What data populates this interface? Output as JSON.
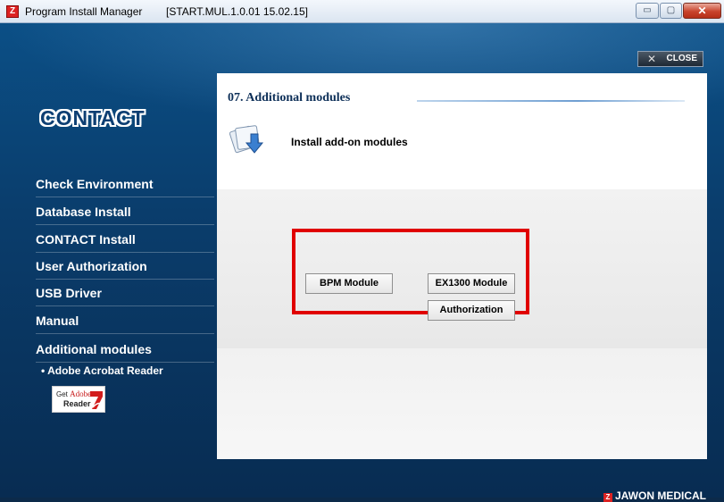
{
  "window": {
    "title": "Program Install Manager",
    "version": "[START.MUL.1.0.01 15.02.15]",
    "app_icon_letter": "Z",
    "minimize_glyph": "▭",
    "maximize_glyph": "▢",
    "close_glyph": "✕"
  },
  "header": {
    "close_x": "✕",
    "close_label": "CLOSE"
  },
  "logo": {
    "text": "CONTACT"
  },
  "sidebar": {
    "items": [
      {
        "label": "Check Environment"
      },
      {
        "label": "Database Install"
      },
      {
        "label": "CONTACT Install"
      },
      {
        "label": "User Authorization"
      },
      {
        "label": "USB Driver"
      },
      {
        "label": "Manual"
      },
      {
        "label": "Additional modules"
      }
    ],
    "sub_item": "• Adobe Acrobat Reader",
    "adobe": {
      "get": "Get",
      "brand": "Adobe",
      "reader": "Reader"
    }
  },
  "main": {
    "section_title": "07. Additional modules",
    "description": "Install add-on modules",
    "buttons": {
      "bpm": "BPM Module",
      "ex1300": "EX1300 Module",
      "authorization": "Authorization"
    }
  },
  "footer": {
    "brand_mark": "Z",
    "brand": "JAWON MEDICAL"
  },
  "colors": {
    "highlight": "#e00000",
    "accent": "#0b4f86"
  }
}
